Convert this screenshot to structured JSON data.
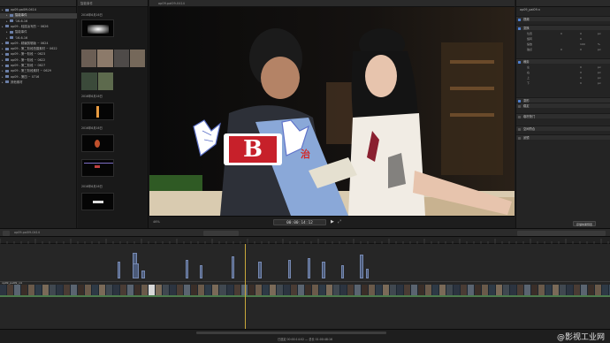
{
  "library": {
    "items": [
      {
        "label": "op09.pal09-0414",
        "selected": false,
        "indent": 0
      },
      {
        "label": "智能事件",
        "selected": true,
        "indent": 1
      },
      {
        "label": "'16-6-16",
        "selected": false,
        "indent": 1
      },
      {
        "label": "op09 - 轻描淡写的 ~ 0626",
        "selected": false,
        "indent": 0
      },
      {
        "label": "智能事件",
        "selected": false,
        "indent": 1
      },
      {
        "label": "'16-6-16",
        "selected": false,
        "indent": 1
      },
      {
        "label": "op09 - 精编剪辑版 ~ 0624",
        "selected": false,
        "indent": 0
      },
      {
        "label": "op09 - 第二阶段拍摄素材 ~ 0622",
        "selected": false,
        "indent": 0
      },
      {
        "label": "op09 - 第一阶段 ~ 0623",
        "selected": false,
        "indent": 0
      },
      {
        "label": "op09 - 第一阶段 ~ 0622",
        "selected": false,
        "indent": 0
      },
      {
        "label": "op09 - 第二阶段 ~ 0627",
        "selected": false,
        "indent": 0
      },
      {
        "label": "op09 - 第三阶段素材 ~ 0629",
        "selected": false,
        "indent": 0
      },
      {
        "label": "op09 - 第四 ~ 0716",
        "selected": false,
        "indent": 0
      },
      {
        "label": "其他素材",
        "selected": false,
        "indent": 0
      }
    ]
  },
  "browser": {
    "title": "智能事件",
    "groups": [
      "2016年6月16日",
      "2016年6月16日",
      "2016年6月16日",
      "2016年6月16日"
    ]
  },
  "viewer": {
    "title": "op09.pal09-0414",
    "timecode": "00:00:14:12",
    "zoom": "46%",
    "overlay_letter": "B",
    "overlay_text": "治"
  },
  "inspector": {
    "title": "op09_pal09.n",
    "sections": [
      {
        "label": "视频",
        "checked": true
      },
      {
        "label": "变换",
        "checked": true
      },
      {
        "label": "裁剪",
        "checked": true
      },
      {
        "label": "变形",
        "checked": true
      },
      {
        "label": "稳定",
        "checked": false
      },
      {
        "label": "卷帘快门",
        "checked": false
      },
      {
        "label": "空间符合",
        "checked": false
      },
      {
        "label": "滤镜",
        "checked": false
      }
    ],
    "rows": [
      {
        "k": "位置",
        "v1": "0",
        "v2": "0",
        "v3": "px"
      },
      {
        "k": "旋转",
        "v1": "",
        "v2": "0",
        "v3": ""
      },
      {
        "k": "缩放",
        "v1": "",
        "v2": "100",
        "v3": "%"
      },
      {
        "k": "锚点",
        "v1": "0",
        "v2": "0",
        "v3": "px"
      },
      {
        "k": "左",
        "v1": "",
        "v2": "0",
        "v3": "px"
      },
      {
        "k": "右",
        "v1": "",
        "v2": "0",
        "v3": "px"
      },
      {
        "k": "上",
        "v1": "",
        "v2": "0",
        "v3": "px"
      },
      {
        "k": "下",
        "v1": "",
        "v2": "0",
        "v3": "px"
      }
    ],
    "footer_button": "存储效果预置"
  },
  "timeline": {
    "project": "op09.pal09-0414",
    "status": "已选定 00:00:14:02 — 总长 01:00:48:16",
    "primary_label": "op09_pal09_n4"
  },
  "watermark": "@影视工业网",
  "colors": {
    "clip_blue": "#4b5a78",
    "clip_green": "#4c7b4c",
    "playhead": "#c9a83b",
    "selection": "#e3c13c"
  }
}
